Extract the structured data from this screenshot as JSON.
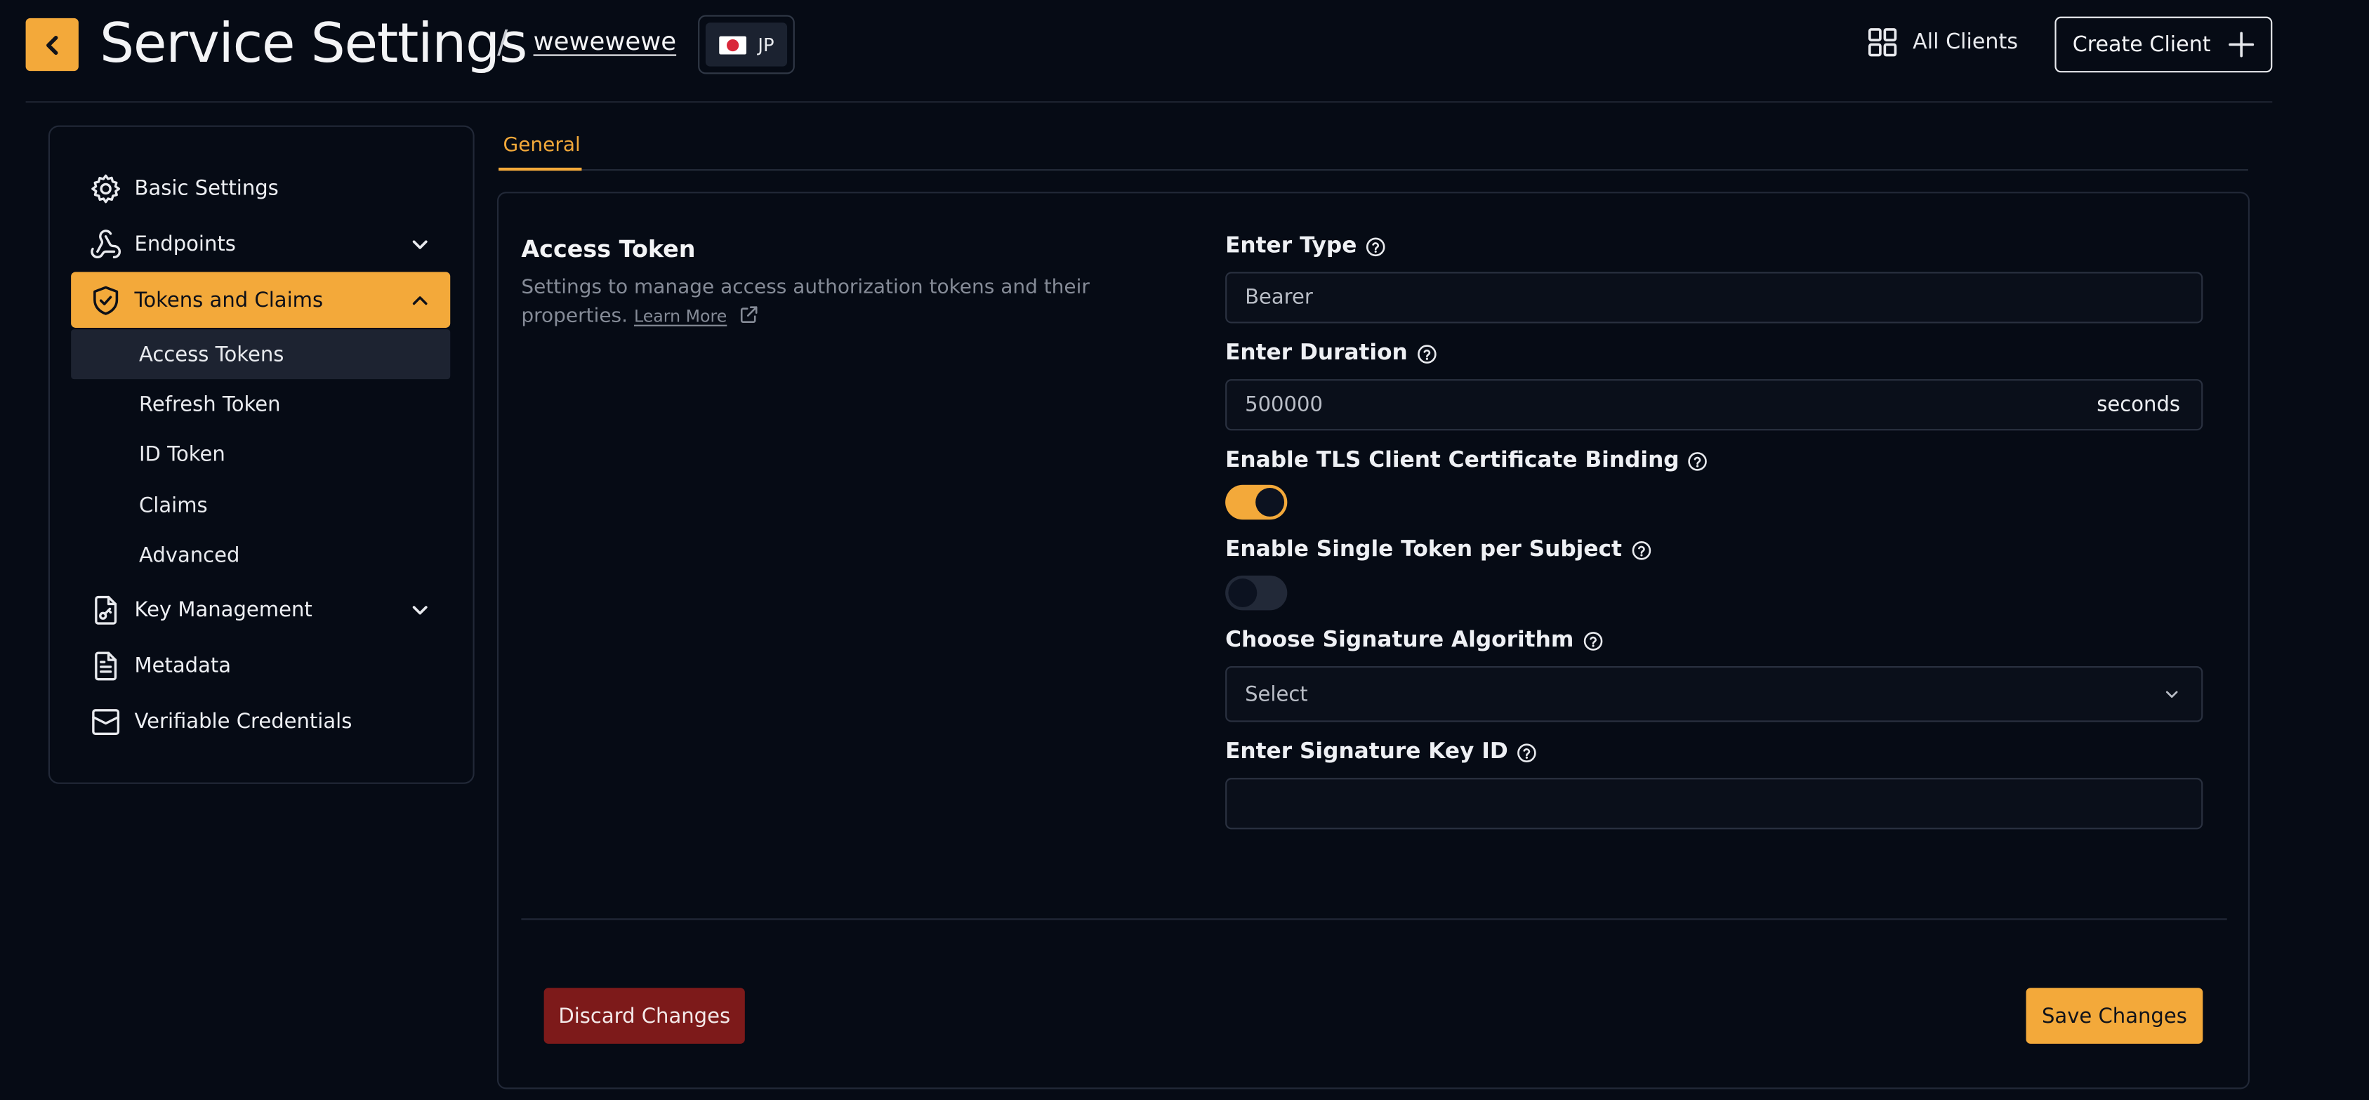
{
  "header": {
    "title": "Service Settings",
    "separator": "/",
    "client_name": "wewewewe",
    "region_code": "JP",
    "all_clients_label": "All Clients",
    "create_client_label": "Create Client"
  },
  "sidebar": {
    "items": [
      {
        "label": "Basic Settings",
        "icon": "gear-icon"
      },
      {
        "label": "Endpoints",
        "icon": "webhook-icon",
        "expandable": true
      },
      {
        "label": "Tokens and Claims",
        "icon": "shield-check-icon",
        "expanded": true,
        "active": true
      },
      {
        "label": "Key Management",
        "icon": "file-key-icon",
        "expandable": true
      },
      {
        "label": "Metadata",
        "icon": "document-icon"
      },
      {
        "label": "Verifiable Credentials",
        "icon": "credential-icon"
      }
    ],
    "sub_items": [
      "Access Tokens",
      "Refresh Token",
      "ID Token",
      "Claims",
      "Advanced"
    ],
    "active_sub_item": "Access Tokens"
  },
  "tabs": [
    {
      "label": "General",
      "active": true
    }
  ],
  "section": {
    "title": "Access Token",
    "description": "Settings to manage access authorization tokens and their properties.",
    "learn_more": "Learn More"
  },
  "form": {
    "type": {
      "label": "Enter Type",
      "value": "Bearer"
    },
    "duration": {
      "label": "Enter Duration",
      "value": "500000",
      "unit": "seconds"
    },
    "tls_binding": {
      "label": "Enable TLS Client Certificate Binding",
      "enabled": true
    },
    "single_token": {
      "label": "Enable Single Token per Subject",
      "enabled": false
    },
    "signature_algorithm": {
      "label": "Choose Signature Algorithm",
      "value": "Select"
    },
    "signature_key_id": {
      "label": "Enter Signature Key ID",
      "value": ""
    }
  },
  "actions": {
    "discard_label": "Discard Changes",
    "save_label": "Save Changes"
  },
  "colors": {
    "accent": "#f3a93a",
    "background": "#060b15",
    "danger": "#7d1a1a"
  }
}
